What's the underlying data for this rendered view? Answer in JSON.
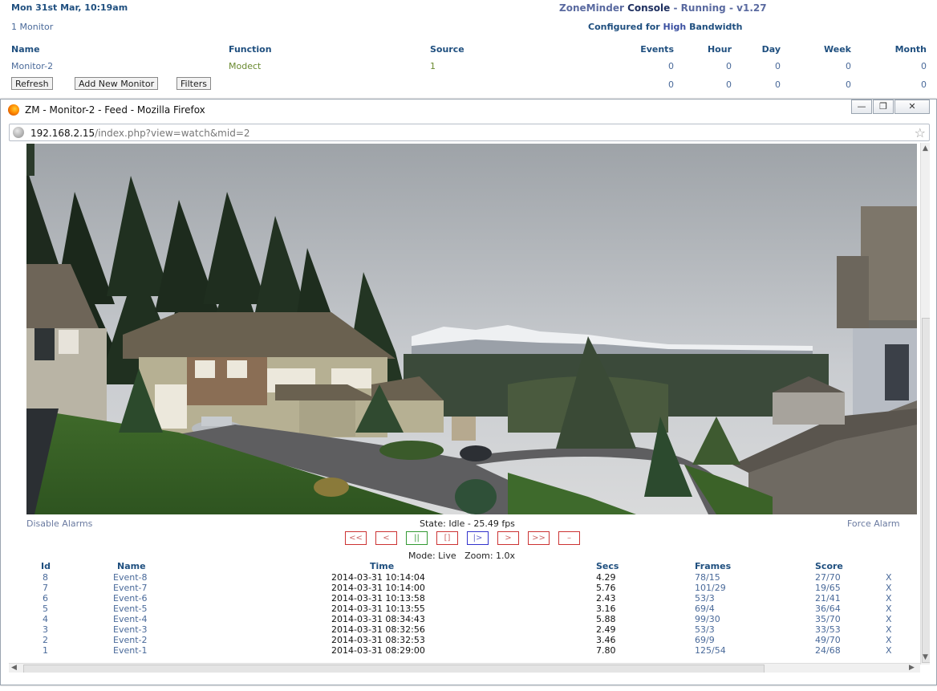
{
  "console": {
    "date": "Mon 31st Mar, 10:19am",
    "title_app": "ZoneMinder",
    "title_console": "Console",
    "title_sep1": "-",
    "title_state": "Running",
    "title_sep2": "-",
    "title_version": "v1.27",
    "bandwidth_prefix": "Configured for",
    "bandwidth_level": "High",
    "bandwidth_suffix": "Bandwidth",
    "monitor_count": "1 Monitor",
    "headers": {
      "name": "Name",
      "function": "Function",
      "source": "Source",
      "events": "Events",
      "hour": "Hour",
      "day": "Day",
      "week": "Week",
      "month": "Month"
    },
    "row": {
      "name": "Monitor-2",
      "function": "Modect",
      "source": "1",
      "events": "0",
      "hour": "0",
      "day": "0",
      "week": "0",
      "month": "0"
    },
    "totals": {
      "events": "0",
      "hour": "0",
      "day": "0",
      "week": "0",
      "month": "0"
    },
    "buttons": {
      "refresh": "Refresh",
      "add_monitor": "Add New Monitor",
      "filters": "Filters"
    }
  },
  "popup": {
    "window_title": "ZM - Monitor-2 - Feed - Mozilla Firefox",
    "url_host": "192.168.2.15",
    "url_path": "/index.php?view=watch&mid=2",
    "window_buttons": {
      "minimize": "—",
      "restore": "❐",
      "close": "✕"
    },
    "disable_alarms": "Disable Alarms",
    "force_alarm": "Force Alarm",
    "state_text": "State: Idle - 25.49 fps",
    "mode_text": "Mode: Live   Zoom: 1.0x",
    "controls": [
      "<<",
      "<",
      "||",
      "[]",
      "|>",
      ">",
      ">>",
      "–"
    ],
    "events_headers": {
      "id": "Id",
      "name": "Name",
      "time": "Time",
      "secs": "Secs",
      "frames": "Frames",
      "score": "Score"
    },
    "events": [
      {
        "id": "8",
        "name": "Event-8",
        "time": "2014-03-31 10:14:04",
        "secs": "4.29",
        "frames": "78/15",
        "score": "27/70",
        "del": "X"
      },
      {
        "id": "7",
        "name": "Event-7",
        "time": "2014-03-31 10:14:00",
        "secs": "5.76",
        "frames": "101/29",
        "score": "19/65",
        "del": "X"
      },
      {
        "id": "6",
        "name": "Event-6",
        "time": "2014-03-31 10:13:58",
        "secs": "2.43",
        "frames": "53/3",
        "score": "21/41",
        "del": "X"
      },
      {
        "id": "5",
        "name": "Event-5",
        "time": "2014-03-31 10:13:55",
        "secs": "3.16",
        "frames": "69/4",
        "score": "36/64",
        "del": "X"
      },
      {
        "id": "4",
        "name": "Event-4",
        "time": "2014-03-31 08:34:43",
        "secs": "5.88",
        "frames": "99/30",
        "score": "35/70",
        "del": "X"
      },
      {
        "id": "3",
        "name": "Event-3",
        "time": "2014-03-31 08:32:56",
        "secs": "2.49",
        "frames": "53/3",
        "score": "33/53",
        "del": "X"
      },
      {
        "id": "2",
        "name": "Event-2",
        "time": "2014-03-31 08:32:53",
        "secs": "3.46",
        "frames": "69/9",
        "score": "49/70",
        "del": "X"
      },
      {
        "id": "1",
        "name": "Event-1",
        "time": "2014-03-31 08:29:00",
        "secs": "7.80",
        "frames": "125/54",
        "score": "24/68",
        "del": "X"
      }
    ]
  },
  "colors": {
    "heading": "#1f4f7f",
    "link": "#4a6a9a",
    "accent_red": "#cc3333",
    "accent_green": "#339933",
    "accent_blue": "#3333cc"
  },
  "icons": [
    "firefox-icon",
    "globe-icon",
    "bookmark-star-icon",
    "minimize-icon",
    "restore-icon",
    "close-icon"
  ]
}
